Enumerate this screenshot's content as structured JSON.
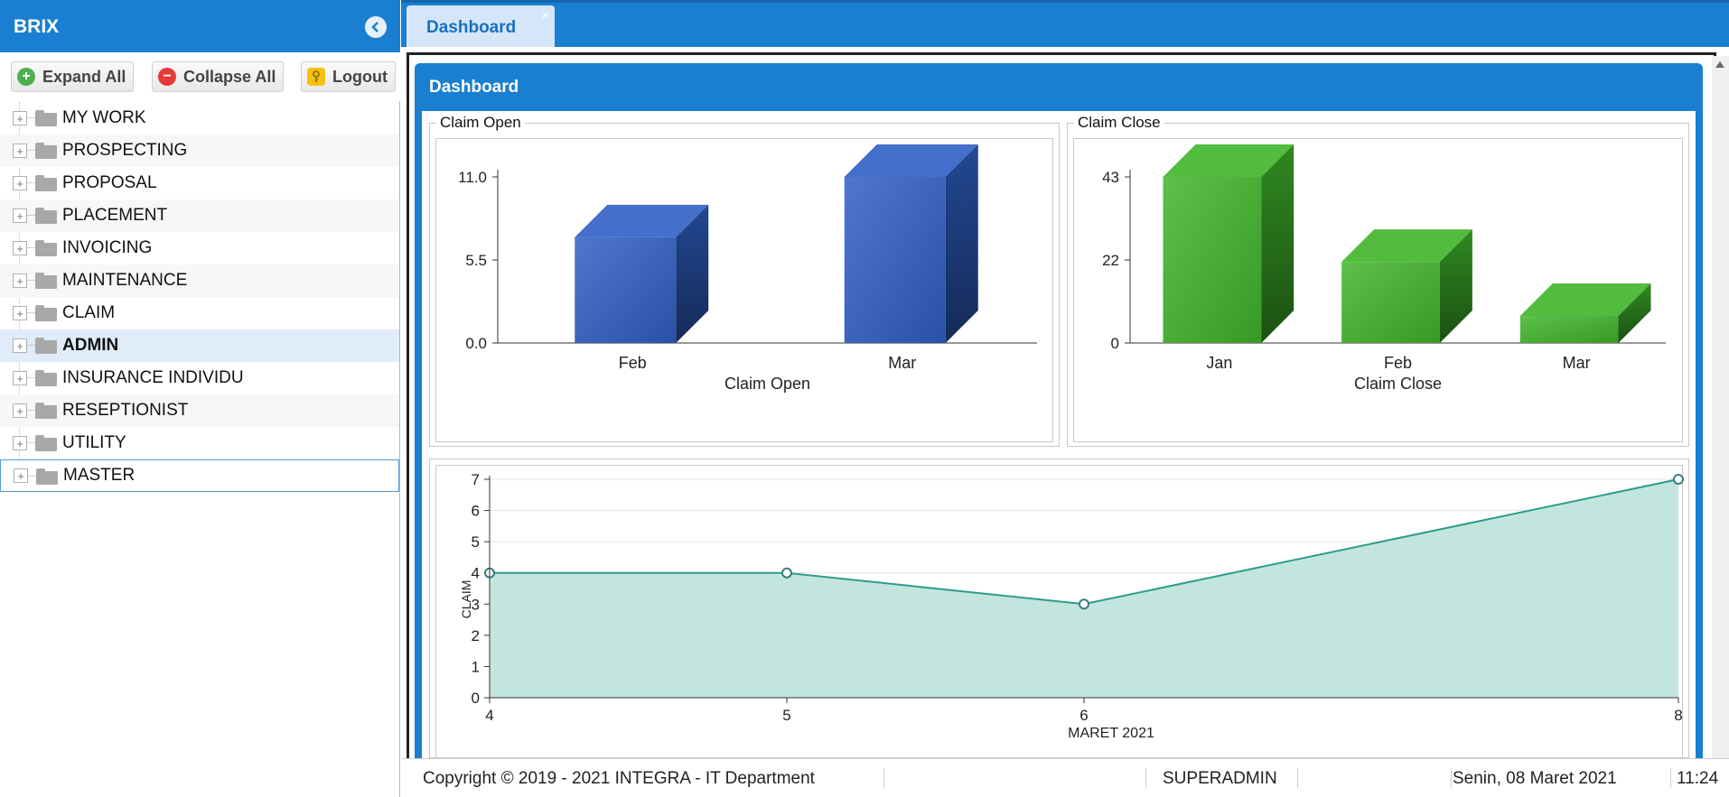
{
  "sidebar": {
    "title": "BRIX",
    "toolbar": {
      "expand_all": "Expand All",
      "collapse_all": "Collapse All",
      "logout": "Logout"
    },
    "items": [
      {
        "label": "MY WORK"
      },
      {
        "label": "PROSPECTING"
      },
      {
        "label": "PROPOSAL"
      },
      {
        "label": "PLACEMENT"
      },
      {
        "label": "INVOICING"
      },
      {
        "label": "MAINTENANCE"
      },
      {
        "label": "CLAIM"
      },
      {
        "label": "ADMIN"
      },
      {
        "label": "INSURANCE INDIVIDU"
      },
      {
        "label": "RESEPTIONIST"
      },
      {
        "label": "UTILITY"
      },
      {
        "label": "MASTER"
      }
    ]
  },
  "tabs": [
    {
      "label": "Dashboard",
      "close": "×"
    }
  ],
  "panel": {
    "title": "Dashboard",
    "claim_open_legend": "Claim Open",
    "claim_close_legend": "Claim Close"
  },
  "chart_data": [
    {
      "type": "bar",
      "categories": [
        "Feb",
        "Mar"
      ],
      "values": [
        7,
        11
      ],
      "xlabel": "Claim Open",
      "yticks": [
        "0.0",
        "5.5",
        "11.0"
      ],
      "ylim": [
        0,
        11
      ],
      "color": "#2f5fc4"
    },
    {
      "type": "bar",
      "categories": [
        "Jan",
        "Feb",
        "Mar"
      ],
      "values": [
        43,
        21,
        7
      ],
      "xlabel": "Claim Close",
      "yticks": [
        "0",
        "22",
        "43"
      ],
      "ylim": [
        0,
        43
      ],
      "color": "#3fb52a"
    },
    {
      "type": "area",
      "x": [
        4,
        5,
        6,
        8
      ],
      "y": [
        4,
        4,
        3,
        7
      ],
      "xticks": [
        "4",
        "5",
        "6",
        "8"
      ],
      "yticks": [
        "0",
        "1",
        "2",
        "3",
        "4",
        "5",
        "6",
        "7"
      ],
      "xlabel": "MARET 2021",
      "ylabel": "CLAIM",
      "xlim": [
        4,
        8
      ],
      "ylim": [
        0,
        7
      ],
      "grid": true,
      "color": "#2e9c8a"
    }
  ],
  "statusbar": {
    "copyright": "Copyright © 2019 - 2021 INTEGRA - IT Department",
    "user": "SUPERADMIN",
    "date": "Senin, 08 Maret 2021",
    "time": "11:24"
  }
}
